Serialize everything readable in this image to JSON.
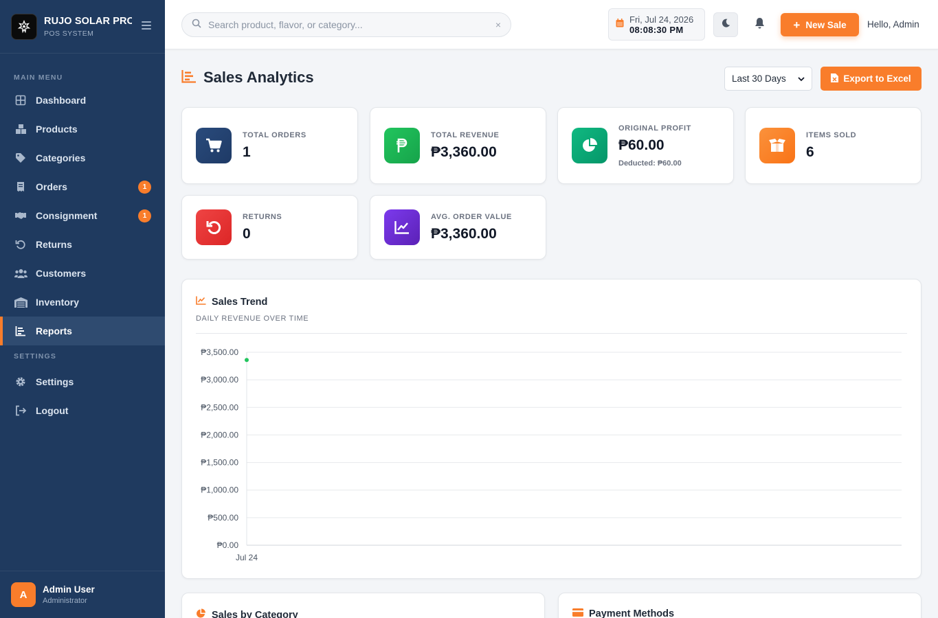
{
  "brand": {
    "name": "RUJO SOLAR PRO",
    "subtitle": "POS SYSTEM"
  },
  "sidebar": {
    "main_section": "MAIN MENU",
    "settings_section": "SETTINGS",
    "items": [
      {
        "label": "Dashboard",
        "icon": "grid-icon"
      },
      {
        "label": "Products",
        "icon": "boxes-icon"
      },
      {
        "label": "Categories",
        "icon": "tags-icon"
      },
      {
        "label": "Orders",
        "icon": "receipt-icon",
        "badge": "1"
      },
      {
        "label": "Consignment",
        "icon": "handshake-icon",
        "badge": "1"
      },
      {
        "label": "Returns",
        "icon": "undo-icon"
      },
      {
        "label": "Customers",
        "icon": "users-icon"
      },
      {
        "label": "Inventory",
        "icon": "warehouse-icon"
      },
      {
        "label": "Reports",
        "icon": "chart-bar-icon",
        "active": true
      }
    ],
    "settings_items": [
      {
        "label": "Settings",
        "icon": "gear-icon"
      },
      {
        "label": "Logout",
        "icon": "logout-icon"
      }
    ],
    "user": {
      "initial": "A",
      "name": "Admin User",
      "role": "Administrator"
    }
  },
  "topbar": {
    "search_placeholder": "Search product, flavor, or category...",
    "date": "Fri, Jul 24, 2026",
    "time": "08:08:30 PM",
    "new_sale_label": "New Sale",
    "greeting": "Hello, Admin"
  },
  "page": {
    "title": "Sales Analytics",
    "range_selected": "Last 30 Days",
    "export_label": "Export to Excel"
  },
  "stats": [
    {
      "label": "TOTAL ORDERS",
      "value": "1",
      "color": "#1e3a8a",
      "icon": "cart-icon"
    },
    {
      "label": "TOTAL REVENUE",
      "value": "₱3,360.00",
      "color": "#16a34a",
      "icon": "peso-icon"
    },
    {
      "label": "ORIGINAL PROFIT",
      "value": "₱60.00",
      "sub": "Deducted: ₱60.00",
      "color": "#059669",
      "icon": "pie-icon"
    },
    {
      "label": "ITEMS SOLD",
      "value": "6",
      "color": "#f97316",
      "icon": "box-open-icon"
    },
    {
      "label": "RETURNS",
      "value": "0",
      "color": "#dc2626",
      "icon": "undo-icon"
    },
    {
      "label": "AVG. ORDER VALUE",
      "value": "₱3,360.00",
      "color": "#6d28d9",
      "icon": "line-chart-icon"
    }
  ],
  "sales_trend": {
    "title": "Sales Trend",
    "subtitle": "DAILY REVENUE OVER TIME"
  },
  "chart_data": {
    "type": "line",
    "title": "Sales Trend",
    "x": [
      "Jul 24"
    ],
    "series": [
      {
        "values": [
          3360
        ],
        "color": "#22c55e"
      }
    ],
    "yticks": [
      "₱0.00",
      "₱500.00",
      "₱1,000.00",
      "₱1,500.00",
      "₱2,000.00",
      "₱2,500.00",
      "₱3,000.00",
      "₱3,500.00"
    ],
    "ylim": [
      0,
      3500
    ],
    "grid": true
  },
  "bottom_cards": [
    {
      "title": "Sales by Category",
      "icon": "pie-icon",
      "color": "#f97316"
    },
    {
      "title": "Payment Methods",
      "icon": "credit-card-icon",
      "color": "#f97316"
    }
  ]
}
